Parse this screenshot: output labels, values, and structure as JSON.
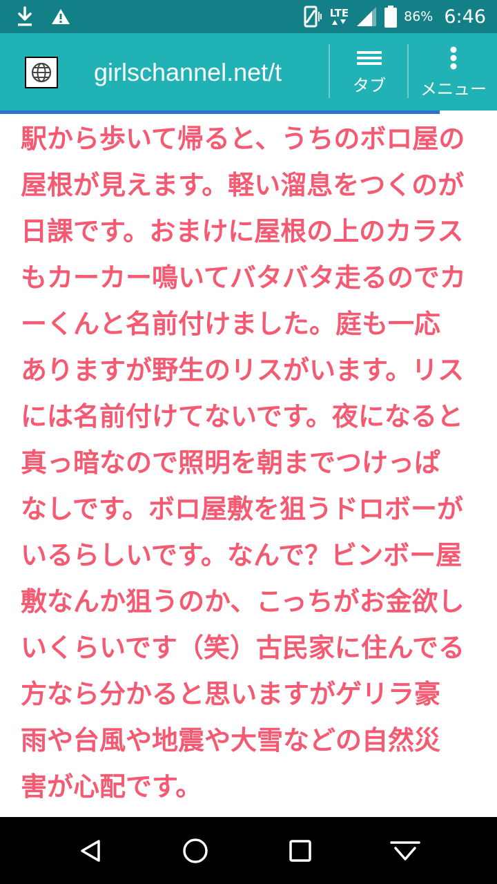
{
  "status_bar": {
    "network_label": "LTE",
    "battery_percent": "86%",
    "time": "6:46"
  },
  "toolbar": {
    "url": "girlschannel.net/t",
    "tab_label": "タブ",
    "menu_label": "メニュー",
    "page_load_progress": 0.885
  },
  "content": {
    "body_text": "駅から歩いて帰ると、うちのボロ屋の屋根が見えます。軽い溜息をつくのが日課です。おまけに屋根の上のカラスもカーカー鳴いてバタバタ走るのでカーくんと名前付けました。庭も一応ありますが野生のリスがいます。リスには名前付けてないです。夜になると真っ暗なので照明を朝までつけっぱなしです。ボロ屋敷を狙うドロボーがいるらしいです。なんで？ビンボー屋敷なんか狙うのか、こっちがお金欲しいくらいです（笑）古民家に住んでる方なら分かると思いますがゲリラ豪雨や台風や地震や大雪などの自然災害が心配です。"
  },
  "colors": {
    "status_bar_bg": "#138088",
    "toolbar_bg": "#21b2b6",
    "text_color": "#f45a72",
    "progress_color": "#2f6fd0"
  }
}
